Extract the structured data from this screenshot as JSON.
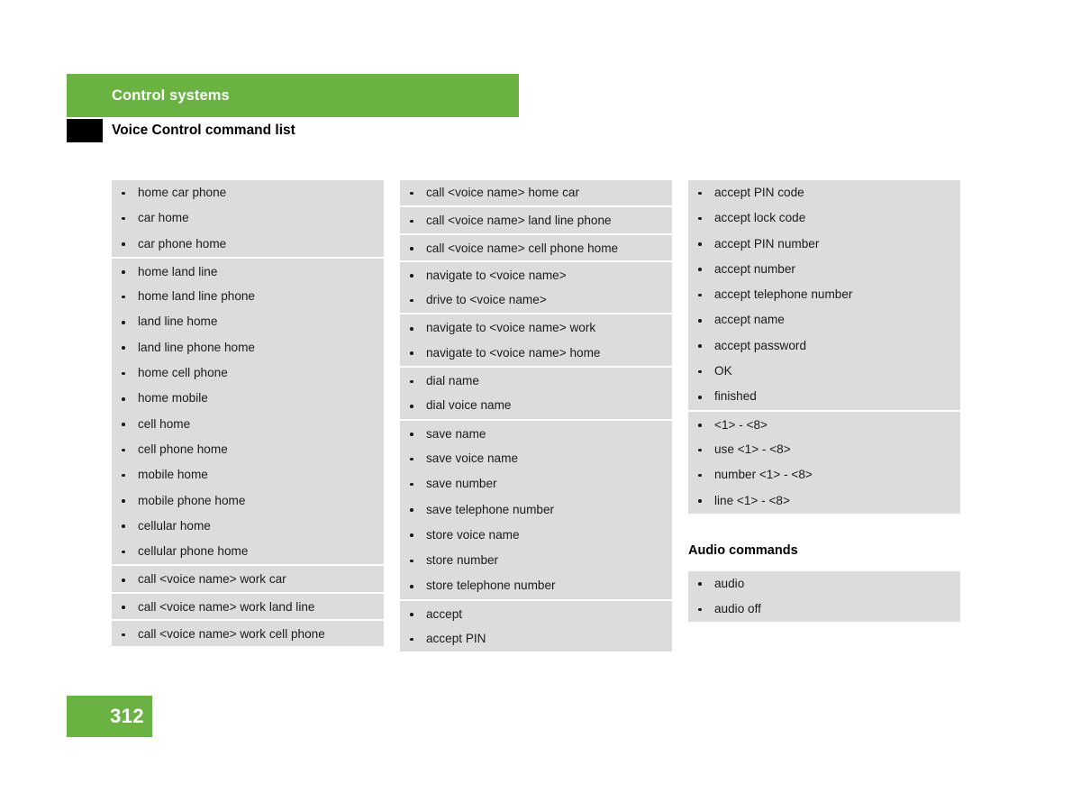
{
  "header": {
    "section_title": "Control systems",
    "page_title": "Voice Control command list",
    "accent_color": "#6ab342",
    "block_color": "#000000"
  },
  "page_footer": {
    "page_number": "312",
    "accent_color": "#6ab342"
  },
  "columns": [
    {
      "id": "column-1",
      "groups": [
        {
          "id": "group-phone-home-variants",
          "items": [
            "home car phone",
            "car home",
            "car phone home"
          ]
        },
        {
          "id": "group-land-line-cell-home",
          "items": [
            "home land line",
            "home land line phone",
            "land line home",
            "land line phone home",
            "home cell phone",
            "home mobile",
            "cell home",
            "cell phone home",
            "mobile home",
            "mobile phone home",
            "cellular home",
            "cellular phone home"
          ]
        },
        {
          "id": "group-call-work-car",
          "items": [
            "call <voice name> work car"
          ]
        },
        {
          "id": "group-call-work-land-line",
          "items": [
            "call <voice name> work land line"
          ]
        },
        {
          "id": "group-call-work-cell-phone",
          "items": [
            "call <voice name> work cell phone"
          ]
        }
      ]
    },
    {
      "id": "column-2",
      "groups": [
        {
          "id": "group-call-home-car",
          "items": [
            "call <voice name> home car"
          ]
        },
        {
          "id": "group-call-land-line-phone",
          "items": [
            "call <voice name> land line phone"
          ]
        },
        {
          "id": "group-call-cell-phone-home",
          "items": [
            "call <voice name> cell phone home"
          ]
        },
        {
          "id": "group-navigate-basic",
          "items": [
            "navigate to <voice name>",
            "drive to <voice name>"
          ]
        },
        {
          "id": "group-navigate-work-home",
          "items": [
            "navigate to <voice name> work",
            "navigate to <voice name> home"
          ]
        },
        {
          "id": "group-dial",
          "items": [
            "dial name",
            "dial voice name"
          ]
        },
        {
          "id": "group-save-store",
          "items": [
            "save name",
            "save voice name",
            "save number",
            "save telephone number",
            "store voice name",
            "store number",
            "store telephone number"
          ]
        },
        {
          "id": "group-accept",
          "items": [
            "accept",
            "accept PIN"
          ]
        }
      ]
    },
    {
      "id": "column-3",
      "groups": [
        {
          "id": "group-accept-codes",
          "items": [
            "accept PIN code",
            "accept lock code",
            "accept PIN number",
            "accept number",
            "accept telephone number",
            "accept name",
            "accept password",
            "OK",
            "finished"
          ]
        },
        {
          "id": "group-numeric-range",
          "items": [
            "<1> - <8>",
            "use <1> - <8>",
            "number <1> - <8>",
            "line <1> - <8>"
          ]
        }
      ],
      "audio_section": {
        "title": "Audio commands",
        "items": [
          "audio",
          "audio off"
        ]
      }
    }
  ]
}
